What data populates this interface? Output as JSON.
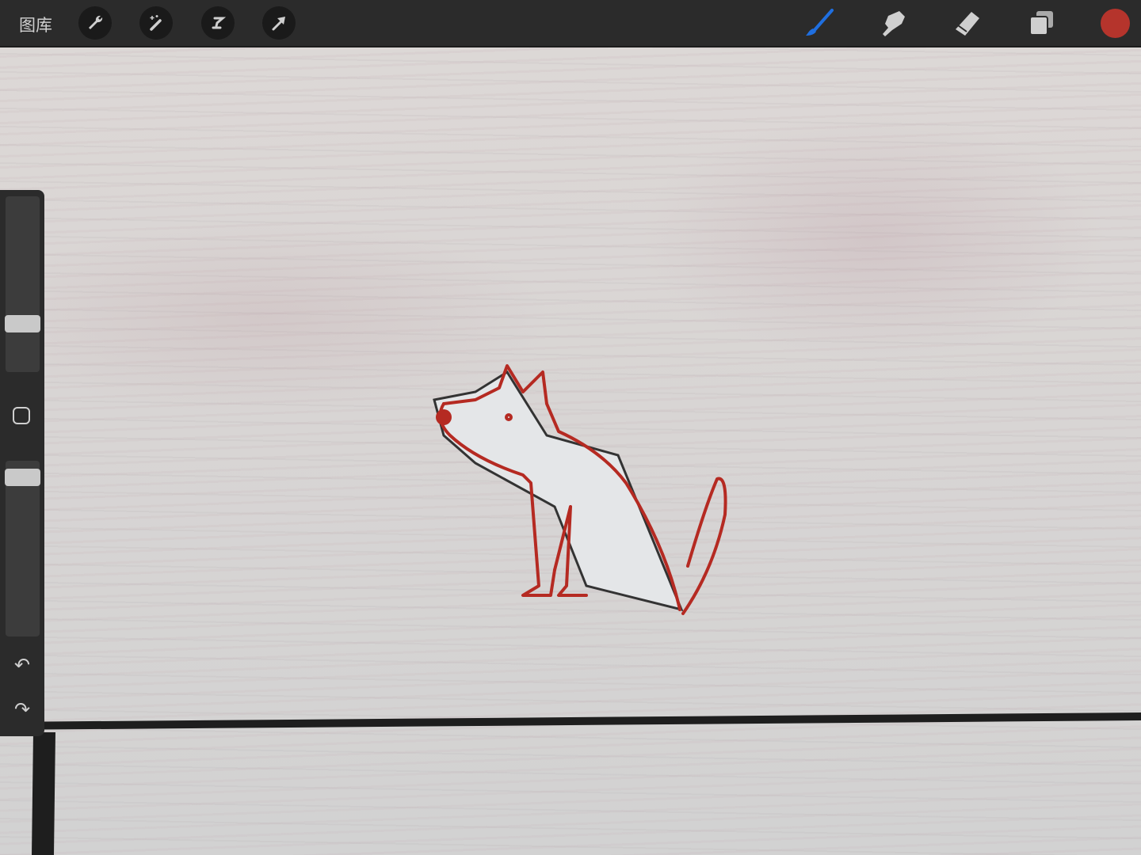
{
  "toolbar": {
    "gallery_label": "图库",
    "left_tools": [
      "wrench-icon",
      "magic-wand-icon",
      "selection-icon",
      "transform-arrow-icon"
    ],
    "right_tools": [
      "brush-icon",
      "smudge-icon",
      "eraser-icon",
      "layers-icon"
    ],
    "active_tool": "brush",
    "accent_color": "#1f6fe0",
    "current_color": "#b5342c"
  },
  "sidebar": {
    "brush_size": 0.25,
    "opacity": 0.95
  }
}
